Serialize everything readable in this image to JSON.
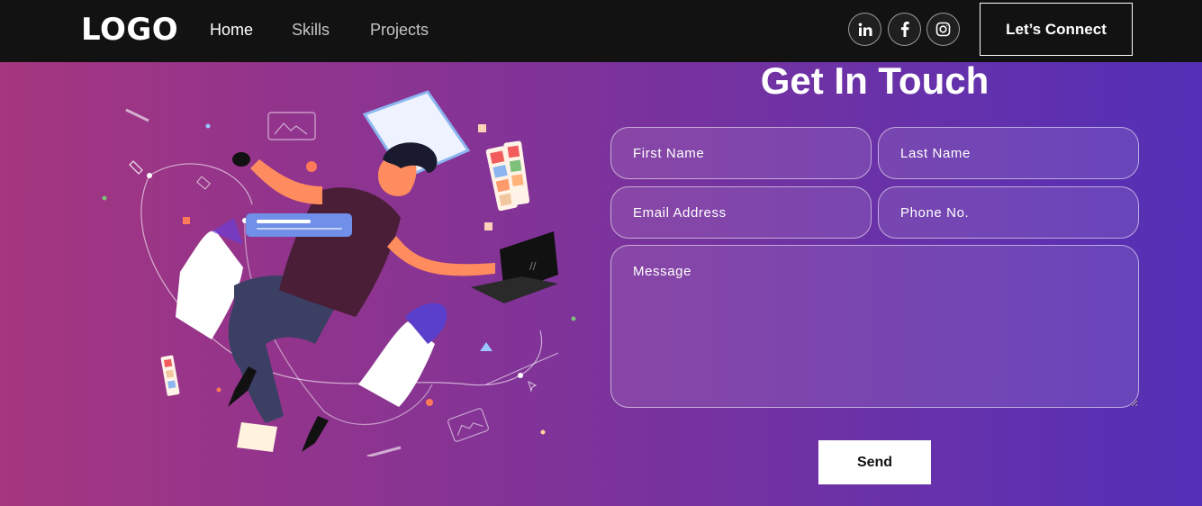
{
  "navbar": {
    "logo": "LOGO",
    "links": [
      {
        "label": "Home"
      },
      {
        "label": "Skills"
      },
      {
        "label": "Projects"
      }
    ],
    "social_icons": [
      "linkedin-icon",
      "facebook-icon",
      "instagram-icon"
    ],
    "connect_label": "Let’s Connect"
  },
  "contact": {
    "title": "Get In Touch",
    "fields": {
      "first_name": "First Name",
      "last_name": "Last Name",
      "email": "Email Address",
      "phone": "Phone No.",
      "message": "Message"
    },
    "send_label": "Send"
  },
  "colors": {
    "navbar_bg": "#121212",
    "gradient_start": "#AA367C",
    "gradient_end": "#4A2FBD"
  }
}
